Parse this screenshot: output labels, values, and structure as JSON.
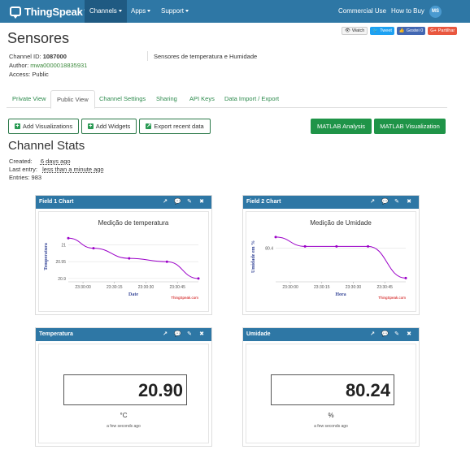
{
  "nav": {
    "brand": "ThingSpeak",
    "tm": "™",
    "channels": "Channels",
    "apps": "Apps",
    "support": "Support",
    "commercial_use": "Commercial Use",
    "how_to_buy": "How to Buy",
    "user_initials": "MS"
  },
  "header": {
    "title": "Sensores",
    "share": {
      "watch": "Watch",
      "tweet": "Tweet",
      "gostei": "Gostei 0",
      "partilhar": "Partilhar"
    }
  },
  "channel": {
    "id_label": "Channel ID:",
    "id": "1087000",
    "author_label": "Author:",
    "author": "mwa0000018835931",
    "access_label": "Access:",
    "access": "Public",
    "description": "Sensores de temperatura e Humidade"
  },
  "tabs": [
    "Private View",
    "Public View",
    "Channel Settings",
    "Sharing",
    "API Keys",
    "Data Import / Export"
  ],
  "actions": {
    "add_visualizations": "Add Visualizations",
    "add_widgets": "Add Widgets",
    "export_recent": "Export recent data",
    "matlab_analysis": "MATLAB Analysis",
    "matlab_visualization": "MATLAB Visualization"
  },
  "stats": {
    "title": "Channel Stats",
    "created_label": "Created:",
    "created": "6 days ago",
    "last_entry_label": "Last entry:",
    "last_entry": "less than a minute ago",
    "entries_label": "Entries:",
    "entries": "983"
  },
  "panels": {
    "field1": {
      "title": "Field 1 Chart"
    },
    "field2": {
      "title": "Field 2 Chart"
    },
    "temp": {
      "title": "Temperatura",
      "value": "20.90",
      "unit": "°C",
      "time": "a few seconds ago"
    },
    "umid": {
      "title": "Umidade",
      "value": "80.24",
      "unit": "%",
      "time": "a few seconds ago"
    }
  },
  "icons": [
    "external-link-icon",
    "comment-icon",
    "pencil-icon",
    "close-icon"
  ],
  "colors": {
    "nav": "#2e77a5",
    "green": "#1f9448",
    "series": "#9b00c8"
  },
  "chart_data": [
    {
      "type": "line",
      "title": "Medição de temperatura",
      "xlabel": "Date",
      "ylabel": "Temperatura",
      "x": [
        "23:29:53",
        "23:30:05",
        "23:30:22",
        "23:30:40",
        "23:30:55"
      ],
      "y": [
        21.02,
        20.99,
        20.96,
        20.95,
        20.9
      ],
      "xticks": [
        "23:30:00",
        "23:30:15",
        "23:30:30",
        "23:30:45"
      ],
      "yticks": [
        20.9,
        20.95,
        21
      ],
      "ylim": [
        20.89,
        21.04
      ],
      "credit": "ThingSpeak.com",
      "grid": true
    },
    {
      "type": "line",
      "title": "Medição de Umidade",
      "xlabel": "Hora",
      "ylabel": "Umidade em %",
      "x": [
        "23:29:53",
        "23:30:07",
        "23:30:22",
        "23:30:37",
        "23:30:55"
      ],
      "y": [
        80.46,
        80.41,
        80.41,
        80.41,
        80.24
      ],
      "xticks": [
        "23:30:00",
        "23:30:15",
        "23:30:30",
        "23:30:45"
      ],
      "yticks": [
        80.4
      ],
      "ylim": [
        80.22,
        80.49
      ],
      "credit": "ThingSpeak.com",
      "grid": true
    }
  ]
}
